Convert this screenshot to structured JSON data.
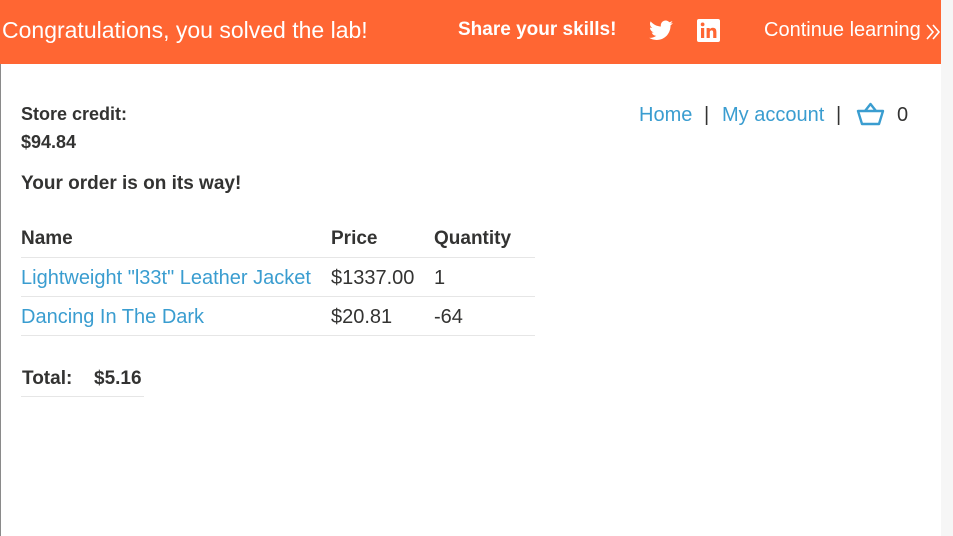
{
  "banner": {
    "title": "Congratulations, you solved the lab!",
    "share_label": "Share your skills!",
    "continue_label": "Continue learning",
    "color": "#ff6633",
    "icons": [
      "twitter-icon",
      "linkedin-icon",
      "double-chevron-right-icon"
    ]
  },
  "account": {
    "store_credit_label": "Store credit:",
    "store_credit_value": "$94.84"
  },
  "nav": {
    "home": "Home",
    "separator": "|",
    "my_account": "My account",
    "cart_count": "0",
    "link_color": "#3a9dd0",
    "cart_icon": "basket-icon"
  },
  "order": {
    "message": "Your order is on its way!",
    "columns": [
      "Name",
      "Price",
      "Quantity"
    ],
    "items": [
      {
        "name": "Lightweight \"l33t\" Leather Jacket",
        "price": "$1337.00",
        "quantity": "1"
      },
      {
        "name": "Dancing In The Dark",
        "price": "$20.81",
        "quantity": "-64"
      }
    ],
    "total_label": "Total:",
    "total_value": "$5.16"
  }
}
